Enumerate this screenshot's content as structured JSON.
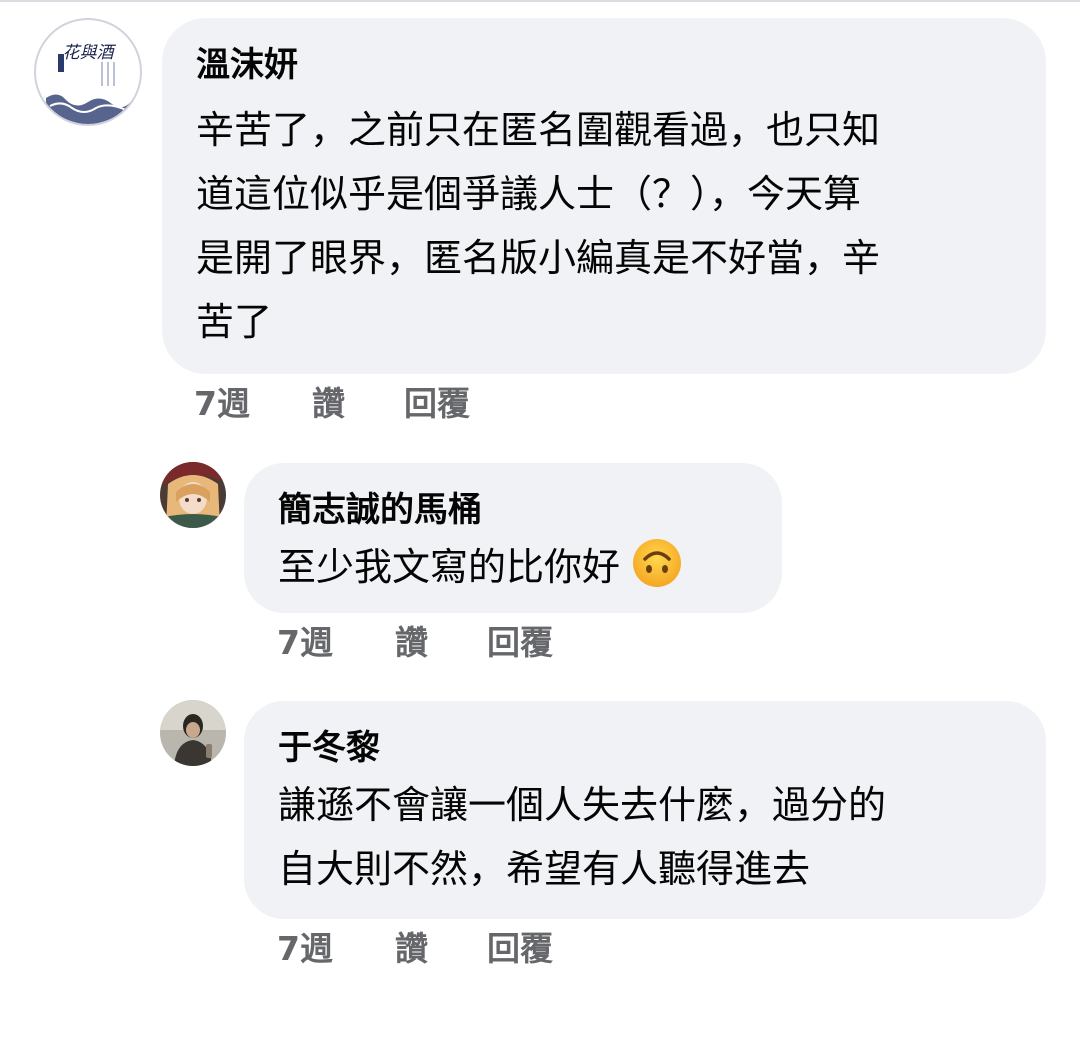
{
  "comments": [
    {
      "name": "溫沫妍",
      "avatar_icon": "flower-wine-logo-icon",
      "avatar_text": "花與酒",
      "lines": [
        "辛苦了，之前只在匿名圍觀看過，也只知",
        "道這位似乎是個爭議人士（？），今天算",
        "是開了眼界，匿名版小編真是不好當，辛",
        "苦了"
      ],
      "time": "7週",
      "like": "讚",
      "reply": "回覆"
    },
    {
      "name": "簡志誠的馬桶",
      "avatar_icon": "anime-girl-avatar-icon",
      "lines": [
        "至少我文寫的比你好"
      ],
      "emoji_icon": "upside-down-face-emoji-icon",
      "time": "7週",
      "like": "讚",
      "reply": "回覆"
    },
    {
      "name": "于冬黎",
      "avatar_icon": "person-photo-avatar-icon",
      "lines": [
        "謙遜不會讓一個人失去什麼，過分的",
        "自大則不然，希望有人聽得進去"
      ],
      "time": "7週",
      "like": "讚",
      "reply": "回覆"
    }
  ],
  "colors": {
    "bubble_bg": "#f0f2f5",
    "name_text": "#050505",
    "meta_text": "#65676b"
  }
}
